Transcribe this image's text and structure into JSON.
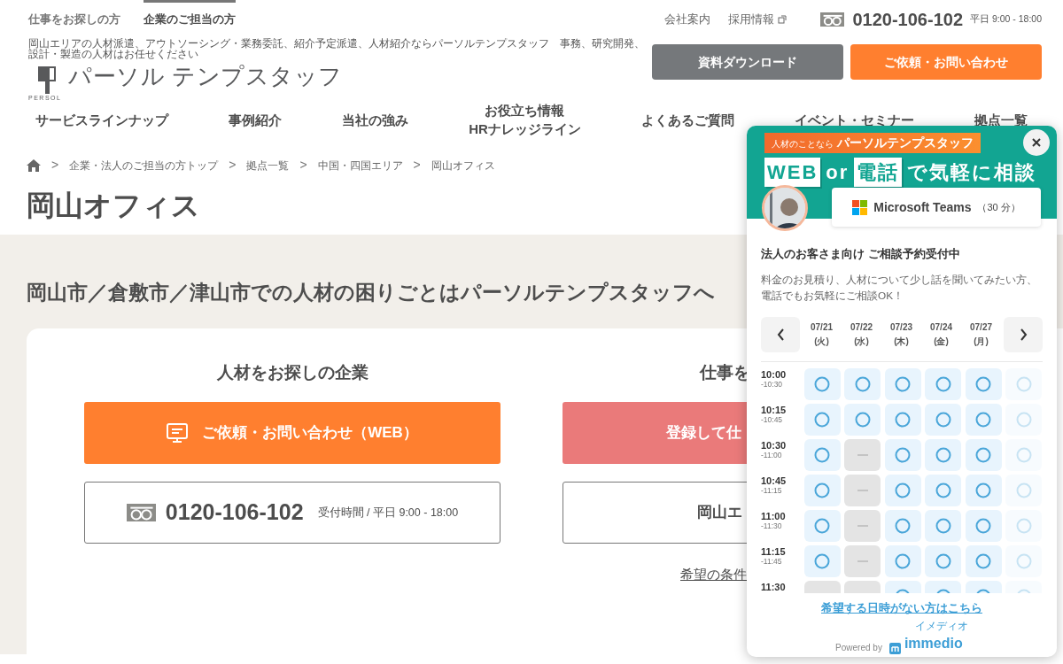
{
  "top_tabs": [
    {
      "label": "仕事をお探しの方",
      "selected": false
    },
    {
      "label": "企業のご担当の方",
      "selected": true
    }
  ],
  "utility_links": [
    {
      "label": "会社案内",
      "external": false
    },
    {
      "label": "採用情報",
      "external": true
    }
  ],
  "phone": {
    "number": "0120-106-102",
    "hours": "平日 9:00 - 18:00"
  },
  "tagline": "岡山エリアの人材派遣、アウトソーシング・業務委託、紹介予定派遣、人材紹介ならパーソルテンプスタッフ　事務、研究開発、設計・製造の人材はお任せください",
  "logo": {
    "caption": "PERSOL",
    "name": "パーソル テンプスタッフ"
  },
  "header_buttons": [
    {
      "label": "資料ダウンロード",
      "kind": "secondary"
    },
    {
      "label": "ご依頼・お問い合わせ",
      "kind": "primary"
    }
  ],
  "nav": [
    {
      "label": "サービスラインナップ"
    },
    {
      "label": "事例紹介"
    },
    {
      "label": "当社の強み"
    },
    {
      "label": "お役立ち情報\nHRナレッジライン"
    },
    {
      "label": "よくあるご質問"
    },
    {
      "label": "イベント・セミナー"
    },
    {
      "label": "拠点一覧"
    }
  ],
  "breadcrumb": [
    {
      "separator": ">",
      "label": "企業・法人のご担当の方トップ"
    },
    {
      "separator": ">",
      "label": "拠点一覧"
    },
    {
      "separator": ">",
      "label": "中国・四国エリア"
    },
    {
      "separator": ">",
      "label": "岡山オフィス"
    }
  ],
  "page_title": "岡山オフィス",
  "section_heading": "岡山市／倉敷市／津山市での人材の困りごとはパーソルテンプスタッフへ",
  "columns": [
    {
      "heading": "人材をお探しの企業",
      "main_button": {
        "label": "ご依頼・お問い合わせ（WEB）",
        "kind": "web"
      },
      "phone": {
        "number": "0120-106-102",
        "hours": "受付時間 / 平日 9:00 - 18:00"
      }
    },
    {
      "heading": "仕事を",
      "main_button": {
        "label": "登録して仕",
        "kind": "register"
      },
      "outline_button": {
        "label": "岡山エ"
      },
      "link": "希望の条件"
    }
  ],
  "widget": {
    "tag_prefix": "人材のことなら",
    "tag_brand": "パーソルテンプスタッフ",
    "headline": [
      {
        "text": "WEB",
        "boxed": true
      },
      {
        "text": "or",
        "boxed": false
      },
      {
        "text": "電話",
        "boxed": true
      },
      {
        "text": "で気軽に相談",
        "boxed": false
      }
    ],
    "tool": {
      "name": "Microsoft Teams",
      "duration": "（30 分）"
    },
    "title": "法人のお客さま向け ご相談予約受付中",
    "description": "料金のお見積り、人材について少し話を聞いてみたい方、電話でもお気軽にご相談OK！",
    "dates": [
      {
        "date": "07/21",
        "weekday": "(火)"
      },
      {
        "date": "07/22",
        "weekday": "(水)"
      },
      {
        "date": "07/23",
        "weekday": "(木)"
      },
      {
        "date": "07/24",
        "weekday": "(金)"
      },
      {
        "date": "07/27",
        "weekday": "(月)"
      }
    ],
    "slots": [
      {
        "start": "10:00",
        "end": "-10:30",
        "cells": [
          {
            "available": true,
            "faded": false
          },
          {
            "available": true,
            "faded": false
          },
          {
            "available": true,
            "faded": false
          },
          {
            "available": true,
            "faded": false
          },
          {
            "available": true,
            "faded": false
          },
          {
            "available": true,
            "faded": true
          }
        ]
      },
      {
        "start": "10:15",
        "end": "-10:45",
        "cells": [
          {
            "available": true,
            "faded": false
          },
          {
            "available": true,
            "faded": false
          },
          {
            "available": true,
            "faded": false
          },
          {
            "available": true,
            "faded": false
          },
          {
            "available": true,
            "faded": false
          },
          {
            "available": true,
            "faded": true
          }
        ]
      },
      {
        "start": "10:30",
        "end": "-11:00",
        "cells": [
          {
            "available": true,
            "faded": false
          },
          {
            "available": false,
            "faded": false
          },
          {
            "available": true,
            "faded": false
          },
          {
            "available": true,
            "faded": false
          },
          {
            "available": true,
            "faded": false
          },
          {
            "available": true,
            "faded": true
          }
        ]
      },
      {
        "start": "10:45",
        "end": "-11:15",
        "cells": [
          {
            "available": true,
            "faded": false
          },
          {
            "available": false,
            "faded": false
          },
          {
            "available": true,
            "faded": false
          },
          {
            "available": true,
            "faded": false
          },
          {
            "available": true,
            "faded": false
          },
          {
            "available": true,
            "faded": true
          }
        ]
      },
      {
        "start": "11:00",
        "end": "-11:30",
        "cells": [
          {
            "available": true,
            "faded": false
          },
          {
            "available": false,
            "faded": false
          },
          {
            "available": true,
            "faded": false
          },
          {
            "available": true,
            "faded": false
          },
          {
            "available": true,
            "faded": false
          },
          {
            "available": true,
            "faded": true
          }
        ]
      },
      {
        "start": "11:15",
        "end": "-11:45",
        "cells": [
          {
            "available": true,
            "faded": false
          },
          {
            "available": false,
            "faded": false
          },
          {
            "available": true,
            "faded": false
          },
          {
            "available": true,
            "faded": false
          },
          {
            "available": true,
            "faded": false
          },
          {
            "available": true,
            "faded": true
          }
        ]
      },
      {
        "start": "11:30",
        "cells": [
          {
            "available": false,
            "faded": false
          },
          {
            "available": false,
            "faded": false
          },
          {
            "available": true,
            "faded": false
          },
          {
            "available": true,
            "faded": false
          },
          {
            "available": true,
            "faded": false
          },
          {
            "available": true,
            "faded": true
          }
        ]
      }
    ],
    "footer_link": "希望する日時がない方はこちら",
    "powered_by": "Powered by",
    "brand": "immedio",
    "brand_ruby": "イメディオ"
  }
}
